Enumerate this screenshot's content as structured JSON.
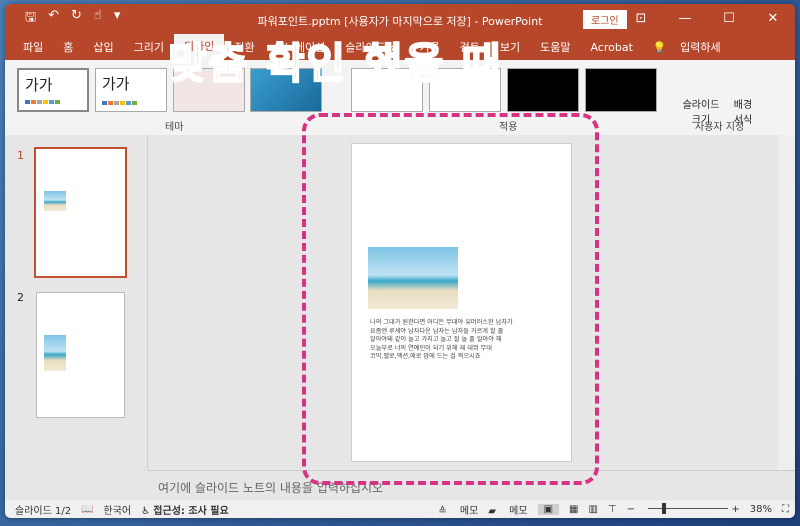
{
  "title": {
    "text": "파워포인트.pptm [사용자가 마지막으로 저장]  -  PowerPoint",
    "login": "로그인"
  },
  "tabs": [
    "파일",
    "홈",
    "삽입",
    "그리기",
    "디자인",
    "전환",
    "애니메이션",
    "슬라이드 쇼",
    "기록",
    "검토",
    "보기",
    "도움말",
    "Acrobat",
    "입력하세"
  ],
  "ribbon": {
    "theme_sample": "가가",
    "theme_group": "테마",
    "apply_group": "적용",
    "slide_size": "슬라이드 크기",
    "bg_format": "배경 서식",
    "custom_group": "사용자 지정"
  },
  "slides": {
    "num1": "1",
    "num2": "2"
  },
  "slide_text": [
    "나의 그대가 원한다면 어디든 무대야 유머러스한 남자가",
    "요즘엔 루세야 남자다운 남자는 남자들 거르게 할 줄",
    "알아야돼 같이 놀고 가지고 놀고 잘 놀 줄 알아야 해",
    "오늘부로 너의 연예인이 되기 위해 재 데뷔 무대",
    "코믹,멜로,액션,에로 맘에 드는 걸 찍으시죠"
  ],
  "notes_placeholder": "여기에 슬라이드 노트의 내용을 입력하십시오",
  "status": {
    "slide": "슬라이드 1/2",
    "lang": "한국어",
    "access": "접근성: 조사 필요",
    "notes": "메모",
    "comments": "메모",
    "zoom": "38%"
  },
  "overlay": "맞춤 확인 했을 때",
  "zoom_percent": 38
}
